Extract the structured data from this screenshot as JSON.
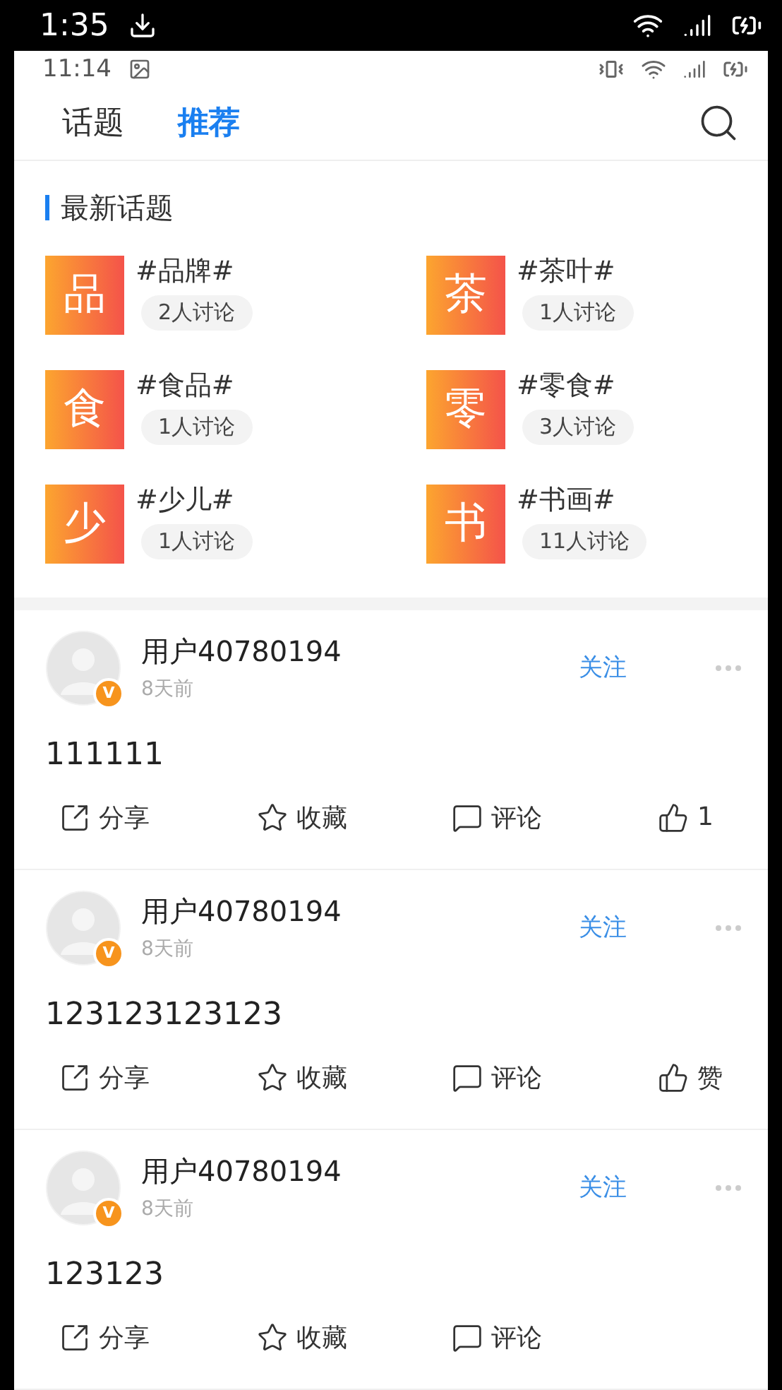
{
  "outer_status_bar": {
    "time": "1:35"
  },
  "inner_status_bar": {
    "time": "11:14"
  },
  "tabs": [
    {
      "label": "话题",
      "selected": false
    },
    {
      "label": "推荐",
      "selected": true
    }
  ],
  "section": {
    "title": "最新话题"
  },
  "topics": [
    {
      "glyph": "品",
      "name": "#品牌#",
      "count": "2人讨论"
    },
    {
      "glyph": "茶",
      "name": "#茶叶#",
      "count": "1人讨论"
    },
    {
      "glyph": "食",
      "name": "#食品#",
      "count": "1人讨论"
    },
    {
      "glyph": "零",
      "name": "#零食#",
      "count": "3人讨论"
    },
    {
      "glyph": "少",
      "name": "#少儿#",
      "count": "1人讨论"
    },
    {
      "glyph": "书",
      "name": "#书画#",
      "count": "11人讨论"
    }
  ],
  "posts": [
    {
      "user": "用户40780194",
      "badge": "V",
      "time": "8天前",
      "follow": "关注",
      "text": "111111",
      "actions": [
        {
          "kind": "share",
          "label": "分享"
        },
        {
          "kind": "collect",
          "label": "收藏"
        },
        {
          "kind": "comment",
          "label": "评论"
        },
        {
          "kind": "like",
          "label": "1"
        }
      ]
    },
    {
      "user": "用户40780194",
      "badge": "V",
      "time": "8天前",
      "follow": "关注",
      "text": "123123123123",
      "actions": [
        {
          "kind": "share",
          "label": "分享"
        },
        {
          "kind": "collect",
          "label": "收藏"
        },
        {
          "kind": "comment",
          "label": "评论"
        },
        {
          "kind": "like",
          "label": "赞"
        }
      ]
    },
    {
      "user": "用户40780194",
      "badge": "V",
      "time": "8天前",
      "follow": "关注",
      "text": "123123",
      "actions": [
        {
          "kind": "share",
          "label": "分享"
        },
        {
          "kind": "collect",
          "label": "收藏"
        },
        {
          "kind": "comment",
          "label": "评论"
        }
      ]
    }
  ]
}
